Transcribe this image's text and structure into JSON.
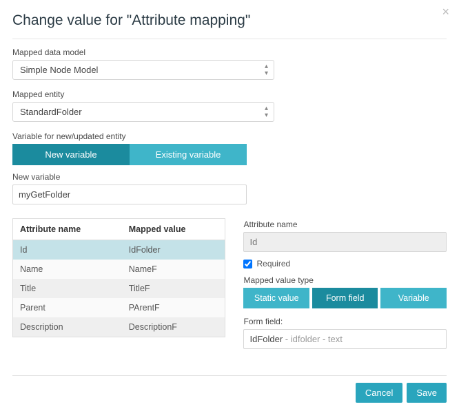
{
  "title": "Change value for \"Attribute mapping\"",
  "labels": {
    "mapped_data_model": "Mapped data model",
    "mapped_entity": "Mapped entity",
    "variable_for": "Variable for new/updated entity",
    "new_variable": "New variable",
    "attribute_name": "Attribute name",
    "required": "Required",
    "mapped_value_type": "Mapped value type",
    "form_field": "Form field:"
  },
  "selects": {
    "data_model": "Simple Node Model",
    "entity": "StandardFolder"
  },
  "variable_toggle": {
    "new": "New variable",
    "existing": "Existing variable"
  },
  "new_variable_value": "myGetFolder",
  "table": {
    "headers": {
      "attr": "Attribute name",
      "mapped": "Mapped value"
    },
    "rows": [
      {
        "attr": "Id",
        "mapped": "IdFolder",
        "selected": true
      },
      {
        "attr": "Name",
        "mapped": "NameF"
      },
      {
        "attr": "Title",
        "mapped": "TitleF"
      },
      {
        "attr": "Parent",
        "mapped": "PArentF"
      },
      {
        "attr": "Description",
        "mapped": "DescriptionF"
      }
    ]
  },
  "right": {
    "attribute_name_value": "Id",
    "required_checked": true,
    "value_type_buttons": {
      "static": "Static value",
      "formfield": "Form field",
      "variable": "Variable"
    },
    "form_field_value": "IdFolder",
    "form_field_suffix": " - idfolder - text"
  },
  "footer": {
    "cancel": "Cancel",
    "save": "Save"
  }
}
